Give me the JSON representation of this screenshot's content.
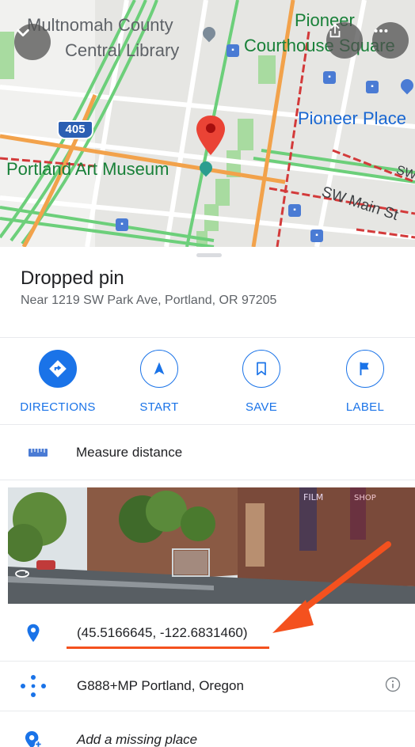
{
  "map": {
    "labels": {
      "library_line1": "Multnomah County",
      "library_line2": "Central Library",
      "pioneer_courthouse_line1": "Pioneer",
      "pioneer_courthouse_line2": "Courthouse Square",
      "pioneer_place": "Pioneer Place",
      "art_museum": "Portland Art Museum",
      "sw_main_st": "SW Main St",
      "sw_partial": "SW",
      "highway": "405"
    }
  },
  "place": {
    "title": "Dropped pin",
    "subtitle": "Near 1219 SW Park Ave, Portland, OR 97205"
  },
  "actions": [
    {
      "label": "DIRECTIONS"
    },
    {
      "label": "START"
    },
    {
      "label": "SAVE"
    },
    {
      "label": "LABEL"
    }
  ],
  "measure": {
    "label": "Measure distance"
  },
  "streetview": {
    "sign_film": "FILM",
    "sign_shop": "SHOP"
  },
  "details": {
    "coordinates": "(45.5166645, -122.6831460)",
    "plus_code": "G888+MP Portland, Oregon",
    "add_place": "Add a missing place"
  },
  "colors": {
    "accent": "#1a73e8",
    "annotation": "#f4511e",
    "pin": "#ea4335"
  }
}
